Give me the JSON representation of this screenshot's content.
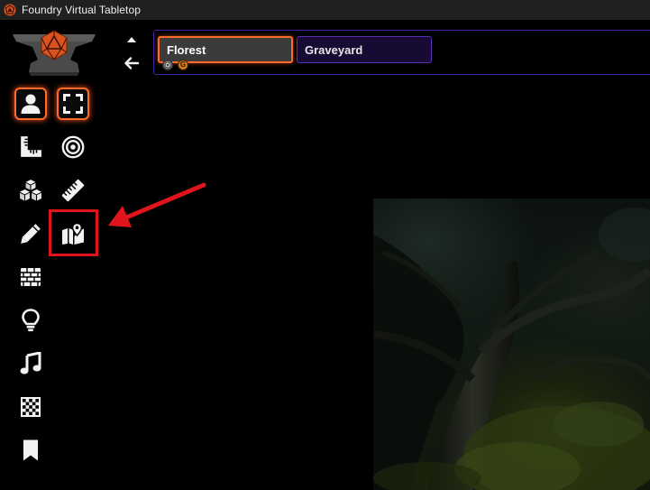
{
  "window": {
    "title": "Foundry Virtual Tabletop"
  },
  "scene_navigation": {
    "scenes": [
      {
        "name": "Florest",
        "active": true
      },
      {
        "name": "Graveyard",
        "active": false
      }
    ],
    "indicators": [
      {
        "type": "gm",
        "label": ""
      },
      {
        "type": "user",
        "label": "G"
      }
    ]
  },
  "scene_controls": {
    "layers": [
      {
        "icon": "user-icon",
        "active": true
      },
      {
        "icon": "ruler-combined-icon",
        "active": false
      },
      {
        "icon": "cubes-icon",
        "active": false
      },
      {
        "icon": "pencil-icon",
        "active": false
      },
      {
        "icon": "brick-wall-icon",
        "active": false
      },
      {
        "icon": "lightbulb-icon",
        "active": false
      },
      {
        "icon": "music-icon",
        "active": false
      },
      {
        "icon": "checkerboard-icon",
        "active": false
      },
      {
        "icon": "bookmark-icon",
        "active": false
      }
    ],
    "tools": [
      {
        "icon": "expand-icon",
        "active": true
      },
      {
        "icon": "bullseye-icon",
        "active": false
      },
      {
        "icon": "ruler-icon",
        "active": false
      },
      {
        "icon": "map-location-icon",
        "active": false,
        "highlighted": true
      }
    ]
  },
  "annotation": {
    "arrow_color": "#e0141c",
    "highlight_color": "#e0141c"
  },
  "colors": {
    "active_glow": "#ff6a2a",
    "scene_nav_border": "#43209a",
    "inactive_scene_bg": "#170a33"
  }
}
